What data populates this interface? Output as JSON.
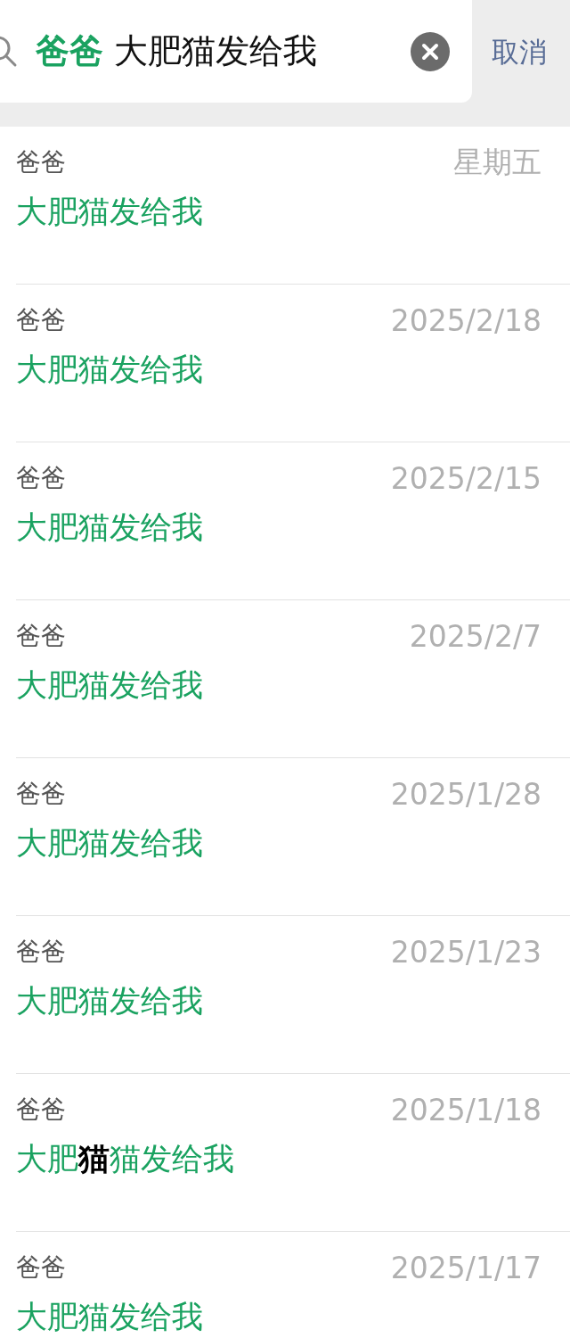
{
  "search": {
    "contact_tag": "爸爸",
    "value": "大肥猫发给我",
    "cancel": "取消"
  },
  "results": [
    {
      "name": "爸爸",
      "date": "星期五",
      "message": [
        {
          "text": "大肥猫发给我",
          "highlighted": true
        }
      ]
    },
    {
      "name": "爸爸",
      "date": "2025/2/18",
      "message": [
        {
          "text": "大肥猫发给我",
          "highlighted": true
        }
      ]
    },
    {
      "name": "爸爸",
      "date": "2025/2/15",
      "message": [
        {
          "text": "大肥猫发给我",
          "highlighted": true
        }
      ]
    },
    {
      "name": "爸爸",
      "date": "2025/2/7",
      "message": [
        {
          "text": "大肥猫发给我",
          "highlighted": true
        }
      ]
    },
    {
      "name": "爸爸",
      "date": "2025/1/28",
      "message": [
        {
          "text": "大肥猫发给我",
          "highlighted": true
        }
      ]
    },
    {
      "name": "爸爸",
      "date": "2025/1/23",
      "message": [
        {
          "text": "大肥猫发给我",
          "highlighted": true
        }
      ]
    },
    {
      "name": "爸爸",
      "date": "2025/1/18",
      "message": [
        {
          "text": "大肥",
          "highlighted": true
        },
        {
          "text": "猫",
          "highlighted": false
        },
        {
          "text": "猫发给我",
          "highlighted": true
        }
      ]
    },
    {
      "name": "爸爸",
      "date": "2025/1/17",
      "message": [
        {
          "text": "大肥猫发给我",
          "highlighted": true
        }
      ]
    }
  ]
}
